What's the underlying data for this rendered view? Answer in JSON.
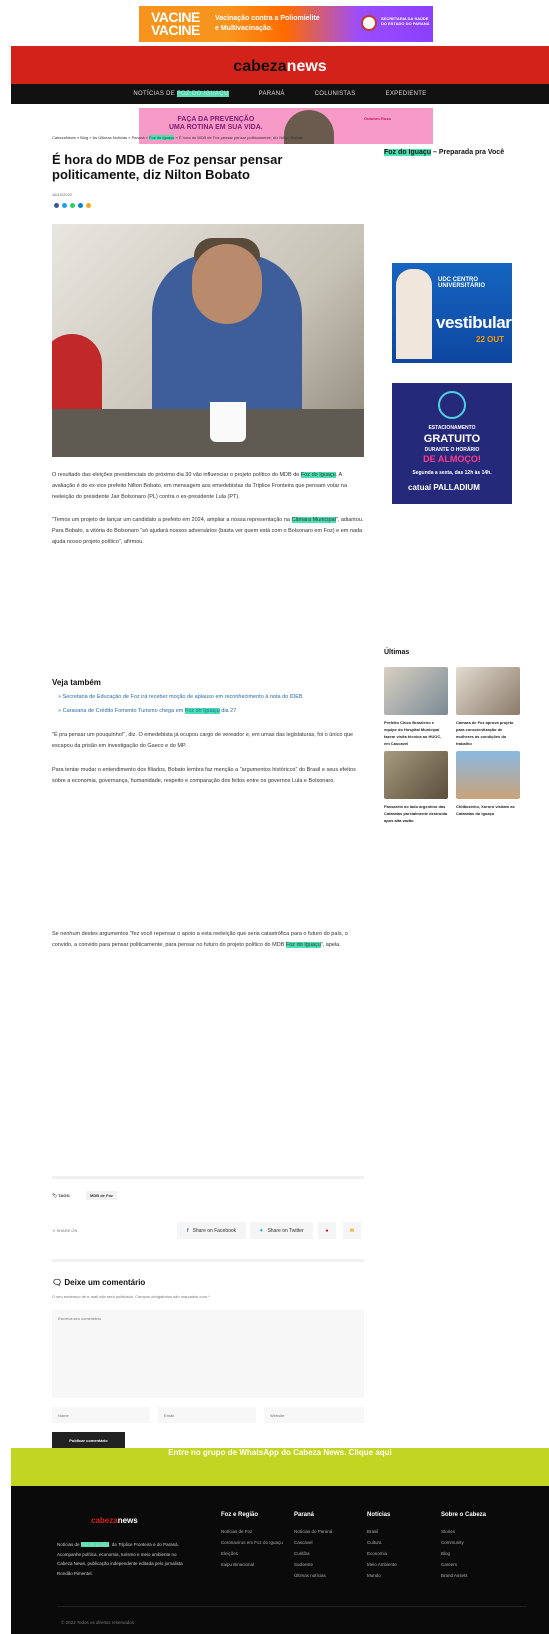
{
  "top_ad": {
    "line1": "VACINE",
    "line2": "VACINE",
    "text1": "Vacinação contra a Poliomielite",
    "text2": "e Multivacinação.",
    "seal": "SECRETARIA DA SAÚDE DO ESTADO DO PARANÁ"
  },
  "logo": {
    "part1": "cabeza",
    "part2": "news"
  },
  "nav": {
    "item1_pre": "NOTÍCIAS DE ",
    "item1_hl": "FOZ DO IGUAÇU",
    "item2": "PARANÁ",
    "item3": "COLUNISTAS",
    "item4": "EXPEDIENTE"
  },
  "ad2": {
    "line1": "FAÇA DA PREVENÇÃO",
    "line2": "UMA ROTINA EM SUA VIDA.",
    "brand": "Outubro Rosa"
  },
  "breadcrumb": {
    "a": "CabezaNews",
    "b": "Blog",
    "c": "As Últimas Notícias",
    "d": "Paraná",
    "e": "Foz do Iguaçu",
    "f": "É hora do MDB de Foz pensar pensar politicamente, diz Nilton Bobato"
  },
  "article": {
    "title": "É hora do MDB de Foz pensar pensar politicamente, diz Nilton Bobato",
    "date": "16/10/2022",
    "p1_pre": "O resultado das eleições presidenciais do próximo dia 30 vão influenciar o projeto político do MDB de ",
    "p1_hl": "Foz do Iguaçu",
    "p1_post": ". A avaliação é do ex-vice prefeito Nilton Bobato, em mensagem aos emedebistas da Tríplice Fronteira que pensam votar na reeleição do presidente Jair Bolsonaro (PL) contra o ex-presidente Lula (PT).",
    "p2_pre": "\"Temos um projeto de lançar um candidato a prefeito em 2024, ampliar a nossa representação na ",
    "p2_hl": "Câmara Municipal",
    "p2_post": "\", adiantou. Para Bobato, a vitória do Bolsonaro \"só ajudará nossos adversários (basta ver quem está com o Bolsonaro em Foz) e em nada ajuda nosso projeto político\", afirmou.",
    "see_also_title": "Veja também",
    "see1": "Secretaria de Educação de Foz irá receber moção de aplauso em reconhecimento à nota do IDEB",
    "see2_pre": "Caravana de Crédito Fomento Turismo chega em ",
    "see2_hl": "Foz do Iguaçu",
    "see2_post": " dia 27",
    "p3": "\"É pra pensar um pouquinho!\", diz. O emedebista já ocupou cargo de vereador e, em umas das legislaturas, foi o único que escapou da prisão em investigação do Gaeco e do MP.",
    "p4": "Para tentar mudar o entendimento dos filiados, Bobato lembra faz menção a \"argumentos históricos\" do Brasil e seus efeitos sobre a economia, governança, humanidade, respeito e comparação dos feitos entre os governos Lula e Bolsonaro.",
    "p5_pre": "Se nenhum destes argumentos \"fez você repensar o apoio a esta reeleição que seria catastrófica para o futuro do país, o convido, a convido para pensar politicamente, para pensar no futuro do projeto político do MDB ",
    "p5_hl": "Foz do Iguaçu",
    "p5_post": "\", apela."
  },
  "tags": {
    "label": "TAGS:",
    "tag1": "MDB de Foz"
  },
  "share": {
    "label": "SHARE ON",
    "facebook": "Share on Facebook",
    "twitter": "Share on Twitter"
  },
  "comments": {
    "title": "Deixe um comentário",
    "note": "O seu endereço de e-mail não será publicado. Campos obrigatórios são marcados com *",
    "textarea_placeholder": "Escreva seu comentário",
    "name_ph": "Name",
    "email_ph": "Email",
    "website_ph": "Website",
    "submit": "Publicar comentário"
  },
  "sidebar": {
    "title_hl": "Foz do Iguaçu",
    "title_post": " – Preparada pra Você",
    "udc": {
      "l1": "UDC CENTRO UNIVERSITÁRIO",
      "l2": "vestibular",
      "l3": "22 OUT"
    },
    "est": {
      "a": "ESTACIONAMENTO",
      "b": "GRATUITO",
      "c": "DURANTE O HORÁRIO",
      "d": "DE ALMOÇO!",
      "e": "Segunda a sexta, das 12h às 14h.",
      "f": "catuaí PALLADIUM"
    },
    "latest_title": "Últimas",
    "news": [
      {
        "title": "Prefeito Chico Brasileiro e equipe do Hospital Municipal fazem visita técnica ao HUOC, em Cascavel"
      },
      {
        "title": "Câmara de Foz aprova projeto para conscientização de mulheres às condições do trabalho"
      },
      {
        "title": "Passarela no lado argentino das Cataratas parcialmente destruída após alta vazão"
      },
      {
        "title": "Chitãozinho, Xororó visitam as Cataratas do Iguaçu"
      }
    ]
  },
  "whatsapp": "Entre no grupo de WhatsApp do Cabeza News. Clique aqui",
  "footer": {
    "logo1": "cabeza",
    "logo2": "news",
    "desc_pre": "Notícias de ",
    "desc_hl": "Foz do Iguaçu",
    "desc_post": ", da Tríplice Fronteira e do Paraná. Acompanhe política, economia, turismo e meio ambiente no Cabeza News, publicação independente editada pelo jornalista Rondão Pimentel.",
    "cols": [
      {
        "title": "Foz e Região",
        "items": [
          "Notícias de Foz",
          "Coronavírus em Foz do Iguaçu",
          "Eleições",
          "Itaipu Binacional"
        ]
      },
      {
        "title": "Paraná",
        "items": [
          "Notícias do Paraná",
          "Cascavel",
          "Curitiba",
          "Sudoeste",
          "Últimas notícias"
        ]
      },
      {
        "title": "Notícias",
        "items": [
          "Brasil",
          "Cultura",
          "Economia",
          "Meio Ambiente",
          "Mundo"
        ]
      },
      {
        "title": "Sobre o Cabeza",
        "items": [
          "Stories",
          "Community",
          "Blog",
          "Careers",
          "Brand Assets"
        ]
      }
    ],
    "copyright": "© 2022 Todos os direitos reservados"
  }
}
